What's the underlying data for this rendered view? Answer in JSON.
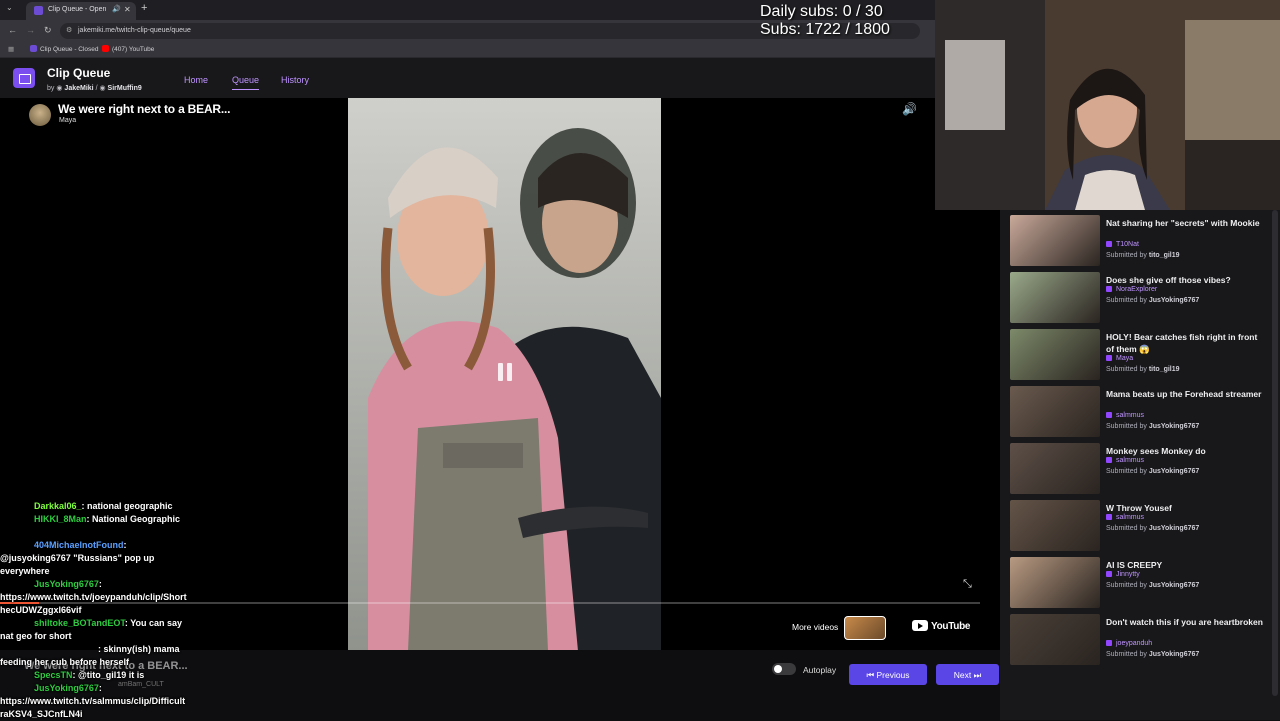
{
  "browser": {
    "tab_active_title": "Clip Queue - Open",
    "new_tab_symbol": "+",
    "url": "jakemiki.me/twitch-clip-queue/queue",
    "bookmarks": [
      "Clip Queue - Closed",
      "(407) YouTube"
    ]
  },
  "overlay": {
    "daily_subs": "Daily subs: 0 / 30",
    "subs": "Subs: 1722 / 1800"
  },
  "app": {
    "title": "Clip Queue",
    "by_prefix": "by",
    "author1": "JakeMiki",
    "separator": "/",
    "author2": "SirMuffin9",
    "nav": [
      "Home",
      "Queue",
      "History"
    ]
  },
  "player": {
    "clip_title": "We were right next to a BEAR...",
    "clip_author": "Maya",
    "progress": 0.04,
    "more_videos": "More videos",
    "youtube_label": "YouTube",
    "ghost_title": "We were right next to a BEAR...",
    "ghost_sub": "amBam_CULT"
  },
  "controls": {
    "autoplay": "Autoplay",
    "previous": "Previous",
    "next": "Next"
  },
  "chat": [
    {
      "user": "Darkkal06_",
      "text": ": national geographic"
    },
    {
      "user": "HIKKI_8Man",
      "text": ": National Geographic"
    },
    {
      "user": "404MichaelnotFound",
      "text": ":"
    },
    {
      "user": "",
      "text": "@jusyoking6767 \"Russians\" pop up"
    },
    {
      "user": "",
      "text": "everywhere"
    },
    {
      "user": "JusYoking6767",
      "text": ":"
    },
    {
      "user": "",
      "text": "https://www.twitch.tv/joeypanduh/clip/Short"
    },
    {
      "user": "",
      "text": "hecUDWZggxl66vif"
    },
    {
      "user": "shiltoke_BOTandEOT",
      "text": ": You can say"
    },
    {
      "user": "",
      "text": "nat geo for short"
    },
    {
      "user": "",
      "text": ": skinny(ish) mama"
    },
    {
      "user": "",
      "text": "feeding her cub before herself"
    },
    {
      "user": "SpecsTN",
      "text": ": @tito_gil19 it is"
    },
    {
      "user": "JusYoking6767",
      "text": ":"
    },
    {
      "user": "",
      "text": "https://www.twitch.tv/salmmus/clip/Difficult"
    },
    {
      "user": "",
      "text": "raKSV4_SJCnfLN4i"
    }
  ],
  "queue": [
    {
      "title": "Nat sharing her \"secrets\" with Mookie",
      "author": "T10Nat",
      "submitted_by": "tito_gil19",
      "thumb_color": "#c9a99a"
    },
    {
      "title": "Does she give off those vibes?",
      "author": "NoraExplorer",
      "submitted_by": "JusYoking6767",
      "thumb_color": "#9aa98a"
    },
    {
      "title": "HOLY! Bear catches fish right in front of them 😱",
      "author": "Maya",
      "submitted_by": "tito_gil19",
      "thumb_color": "#7d8a6a"
    },
    {
      "title": "Mama beats up the Forehead streamer",
      "author": "salmmus",
      "submitted_by": "JusYoking6767",
      "thumb_color": "#6a5a4e"
    },
    {
      "title": "Monkey sees Monkey do",
      "author": "salmmus",
      "submitted_by": "JusYoking6767",
      "thumb_color": "#5e5048"
    },
    {
      "title": "W Throw Yousef",
      "author": "salmmus",
      "submitted_by": "JusYoking6767",
      "thumb_color": "#645448"
    },
    {
      "title": "AI IS CREEPY",
      "author": "Jinnytty",
      "submitted_by": "JusYoking6767",
      "thumb_color": "#b89a82"
    },
    {
      "title": "Don't watch this if you are heartbroken",
      "author": "joeypanduh",
      "submitted_by": "JusYoking6767",
      "thumb_color": "#4a4038"
    }
  ],
  "labels": {
    "submitted_by": "Submitted by"
  },
  "colors": {
    "accent": "#bf94ff",
    "button": "#5a45e6",
    "background": "#0e0e10",
    "panel": "#18181b"
  }
}
